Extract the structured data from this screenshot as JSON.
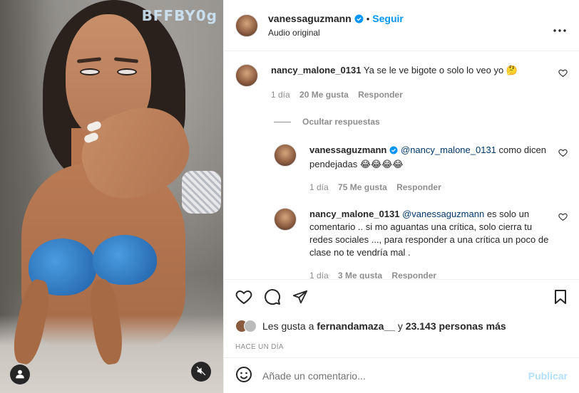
{
  "media": {
    "watermark": "BFFBY0g",
    "user_button_icon": "user-icon",
    "mute_button_icon": "speaker-muted-icon"
  },
  "header": {
    "username": "vanessaguzmann",
    "separator": "•",
    "follow_label": "Seguir",
    "audio_label": "Audio original",
    "more_icon": "more-options-icon"
  },
  "comments": [
    {
      "user": "nancy_malone_0131",
      "text": "Ya se le ve bigote o solo lo veo yo 🤔",
      "time": "1 día",
      "likes": "20 Me gusta",
      "reply_label": "Responder"
    }
  ],
  "replies_toggle": "Ocultar respuestas",
  "replies": [
    {
      "user": "vanessaguzmann",
      "mention": "@nancy_malone_0131",
      "text": " como dicen pendejadas 😂😂😂😂",
      "time": "1 día",
      "likes": "75 Me gusta",
      "reply_label": "Responder"
    },
    {
      "user": "nancy_malone_0131",
      "mention": "@vanessaguzmann",
      "text": " es solo un comentario .. si mo aguantas una crítica, solo cierra tu redes sociales ..., para responder a una crítica un poco de clase no te vendría mal .",
      "time": "1 día",
      "likes": "3 Me gusta",
      "reply_label": "Responder"
    }
  ],
  "likes": {
    "prefix": "Les gusta a ",
    "user": "fernandamaza__",
    "middle": " y ",
    "others": "23.143 personas más"
  },
  "timestamp": "HACE UN DÍA",
  "composer": {
    "placeholder": "Añade un comentario...",
    "post_label": "Publicar"
  },
  "colors": {
    "accent": "#0095f6",
    "post_disabled": "#b2dffc",
    "verified": "#0095f6",
    "muted_text": "#8e8e8e"
  }
}
